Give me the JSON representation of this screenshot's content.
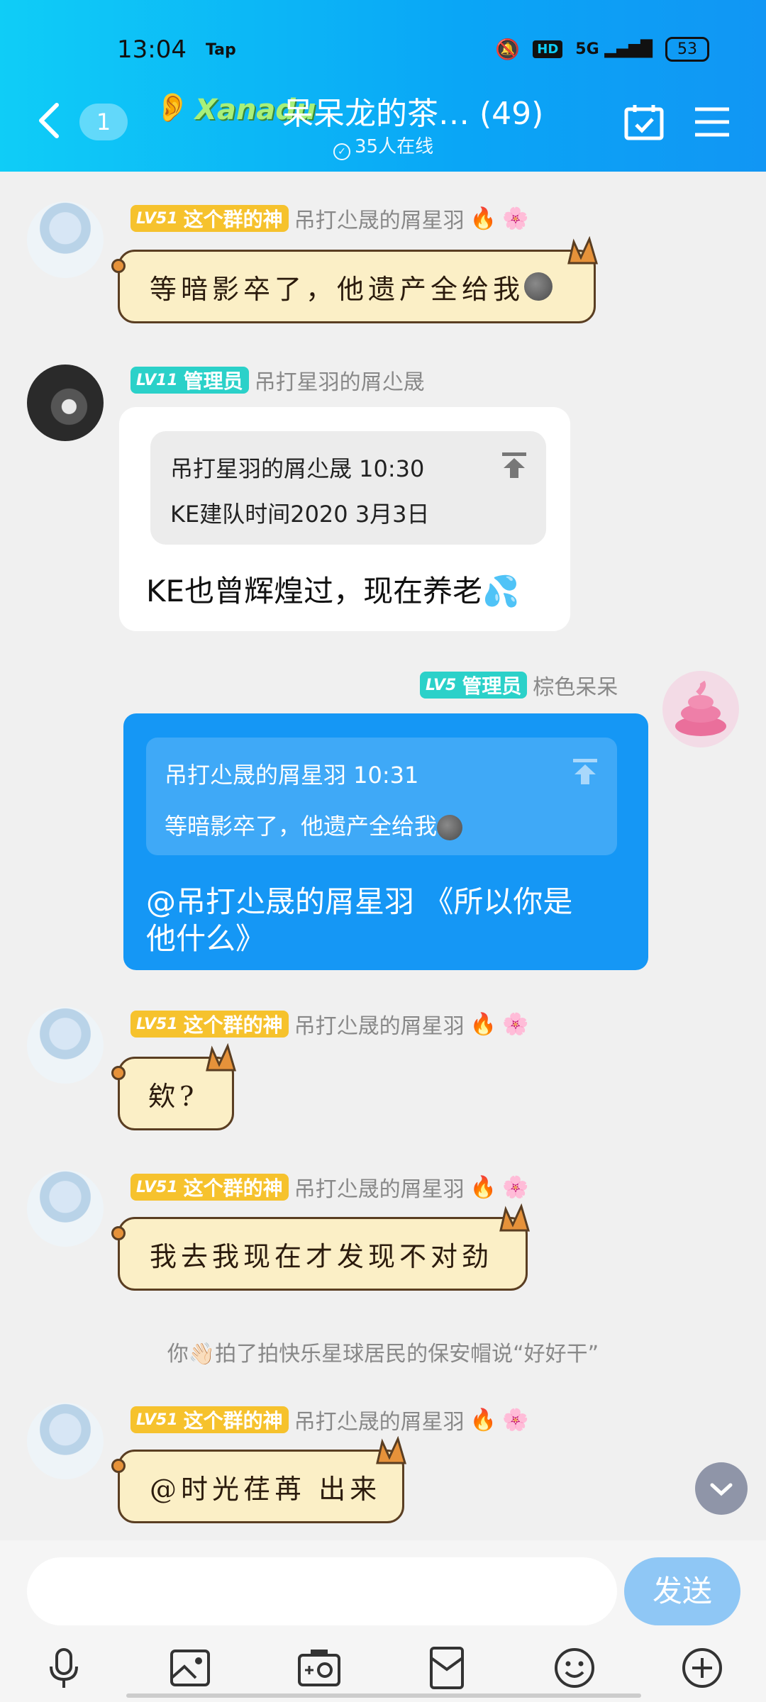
{
  "status": {
    "time": "13:04",
    "tap": "Tap",
    "battery": "53",
    "hd": "HD",
    "signal": "5G"
  },
  "header": {
    "unread": "1",
    "logo_text": "Xanadu",
    "title": "呆呆龙的茶…  (49)",
    "online": "35人在线"
  },
  "messages": [
    {
      "level": "LV51",
      "role": "这个群的神",
      "name": "吊打尐晟的屑星羽",
      "text": "等暗影卒了，他遗产全给我"
    },
    {
      "level": "LV11",
      "role": "管理员",
      "name": "吊打星羽的屑尐晟",
      "quote_header": "吊打星羽的屑尐晟 10:30",
      "quote_text": "KE建队时间2020 3月3日",
      "text": "KE也曾辉煌过，现在养老💦"
    },
    {
      "level": "LV5",
      "role": "管理员",
      "name": "棕色呆呆",
      "quote_header": "吊打尐晟的屑星羽 10:31",
      "quote_text": "等暗影卒了，他遗产全给我",
      "text_line1": "@吊打尐晟的屑星羽 《所以你是",
      "text_line2": "他什么》"
    },
    {
      "level": "LV51",
      "role": "这个群的神",
      "name": "吊打尐晟的屑星羽",
      "text": "欸?"
    },
    {
      "level": "LV51",
      "role": "这个群的神",
      "name": "吊打尐晟的屑星羽",
      "text": "我去我现在才发现不对劲"
    },
    {
      "system": "你👋🏻拍了拍快乐星球居民的保安帽说“好好干”"
    },
    {
      "level": "LV51",
      "role": "这个群的神",
      "name": "吊打尐晟的屑星羽",
      "text": "@时光荏苒 出来"
    }
  ],
  "input": {
    "placeholder": "",
    "send_label": "发送"
  },
  "toolbar": [
    "mic-icon",
    "image-icon",
    "camera-icon",
    "red-packet-icon",
    "emoji-icon",
    "plus-icon"
  ]
}
